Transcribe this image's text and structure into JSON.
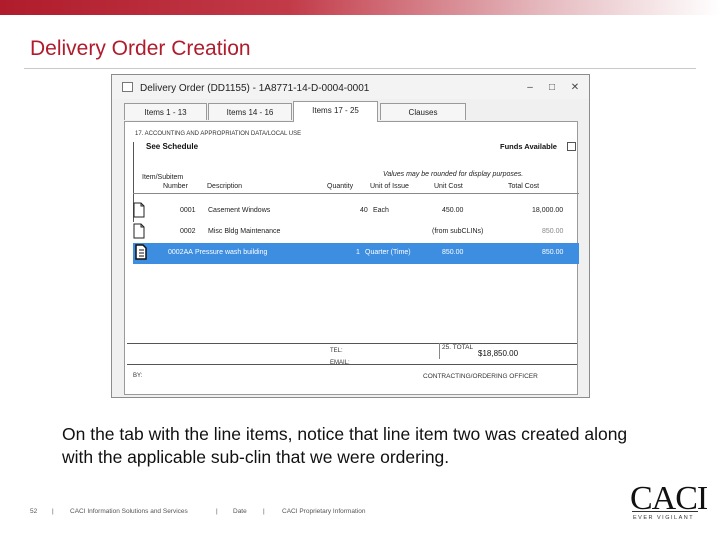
{
  "slide": {
    "title": "Delivery Order Creation",
    "caption": "On the tab with the line items, notice that line item two was created along with the applicable sub-clin that we were ordering.",
    "footer": {
      "page_number": "52",
      "sep1": "|",
      "company": "CACI Information Solutions and Services",
      "sep2": "|",
      "date_label": "Date",
      "sep3": "|",
      "proprietary": "CACI Proprietary Information"
    },
    "logo": {
      "text": "CACI",
      "tagline": "EVER VIGILANT"
    },
    "colors": {
      "accent": "#b01c2c",
      "selection": "#3d8ee0"
    }
  },
  "window": {
    "title": "Delivery Order (DD1155) - 1A8771-14-D-0004-0001",
    "controls": {
      "minimize": "–",
      "maximize": "□",
      "close": "✕"
    },
    "tabs": [
      {
        "label": "Items 1 - 13",
        "active": false
      },
      {
        "label": "Items 14 - 16",
        "active": false
      },
      {
        "label": "Items 17 - 25",
        "active": true
      },
      {
        "label": "Clauses",
        "active": false
      }
    ],
    "panel": {
      "accounting_label": "17. ACCOUNTING AND APPROPRIATION DATA/LOCAL USE",
      "see_schedule": "See Schedule",
      "funds_available": "Funds Available",
      "rounding_note": "Values may be rounded for display purposes.",
      "columns": {
        "item_line1": "Item/Subitem",
        "item_line2": "Number",
        "description": "Description",
        "quantity": "Quantity",
        "unit_of_issue": "Unit of Issue",
        "unit_cost": "Unit Cost",
        "total_cost": "Total Cost"
      },
      "rows": [
        {
          "number": "0001",
          "description": "Casement Windows",
          "quantity": "40",
          "unit": "Each",
          "unit_cost": "450.00",
          "total_cost": "18,000.00",
          "selected": false
        },
        {
          "number": "0002",
          "description": "Misc Bldg Maintenance",
          "quantity": "",
          "unit": "",
          "unit_cost": "(from subCLINs)",
          "total_cost": "850.00",
          "selected": false
        },
        {
          "number": "0002AA",
          "description": "Pressure wash building",
          "quantity": "1",
          "unit": "Quarter (Time)",
          "unit_cost": "850.00",
          "total_cost": "850.00",
          "selected": true
        }
      ],
      "total_label": "25. TOTAL",
      "total_value": "$18,850.00",
      "bottom_labels": {
        "a": "TEL:",
        "b": "EMAIL:",
        "by": "BY:"
      },
      "signature_label": "CONTRACTING/ORDERING OFFICER"
    }
  }
}
